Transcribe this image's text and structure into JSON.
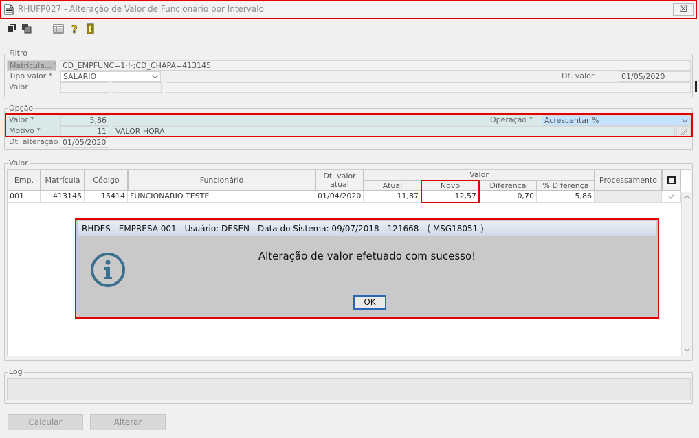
{
  "window": {
    "title": "RHUFP027 - Alteração de Valor de Funcionário por Intervalo",
    "close_glyph": "☒"
  },
  "toolbar": {
    "icons": [
      "export-icon",
      "copy-icon",
      "calendar-grid-icon",
      "help-icon",
      "exit-door-icon"
    ]
  },
  "filtro": {
    "legend": "Filtro",
    "matricula_label": "Matrícula... *",
    "matricula_value": "CD_EMPFUNC=1·!·;CD_CHAPA=413145",
    "tipo_valor_label": "Tipo valor *",
    "tipo_valor_value": "SALARIO",
    "dt_valor_label": "Dt. valor",
    "dt_valor_value": "01/05/2020",
    "valor_label": "Valor"
  },
  "opcao": {
    "legend": "Opção",
    "valor_label": "Valor *",
    "valor_value": "5,86",
    "operacao_label": "Operação *",
    "operacao_value": "Acrescentar %",
    "motivo_label": "Motivo *",
    "motivo_code": "11",
    "motivo_desc": "VALOR HORA",
    "dt_alteracao_label": "Dt. alteração *",
    "dt_alteracao_value": "01/05/2020"
  },
  "grid": {
    "legend": "Valor",
    "headers": {
      "emp": "Emp.",
      "matricula": "Matrícula",
      "codigo": "Código",
      "funcionario": "Funcionário",
      "dt_valor_atual": "Dt. valor atual",
      "valor_group": "Valor",
      "atual": "Atual",
      "novo": "Novo",
      "diferenca": "Diferença",
      "pct_diferenca": "% Diferença",
      "processamento": "Processamento"
    },
    "rows": [
      {
        "emp": "001",
        "matricula": "413145",
        "codigo": "15414",
        "funcionario": "FUNCIONARIO TESTE",
        "dt_valor_atual": "01/04/2020",
        "atual": "11,87",
        "novo": "12,57",
        "diferenca": "0,70",
        "pct_diferenca": "5,86",
        "checked": true
      }
    ]
  },
  "dialog": {
    "title": "RHDES - EMPRESA 001 - Usuário: DESEN - Data do Sistema: 09/07/2018 - 121668 - ( MSG18051 )",
    "message": "Alteração de valor efetuado com sucesso!",
    "ok_label": "OK",
    "icon": "info-icon"
  },
  "log": {
    "legend": "Log"
  },
  "buttons": {
    "calcular": "Calcular",
    "alterar": "Alterar"
  },
  "colors": {
    "highlight": "#e30000",
    "selected_row": "#d9e9ea",
    "info_icon": "#3a6f8f"
  }
}
